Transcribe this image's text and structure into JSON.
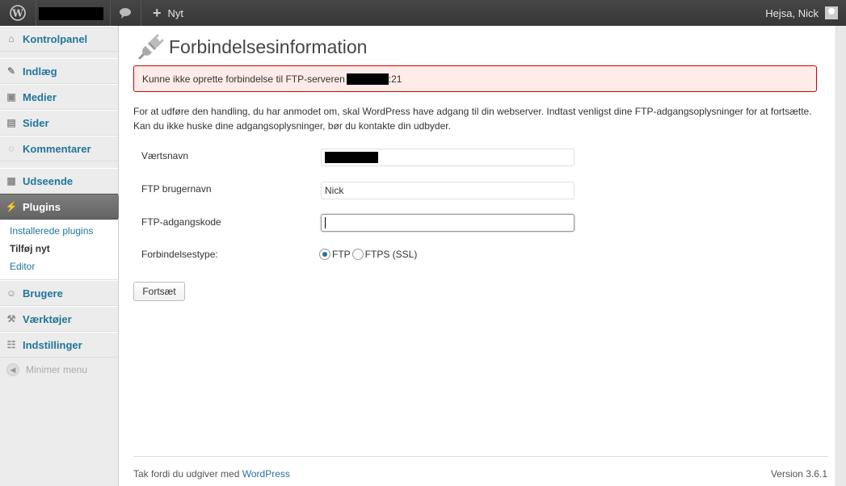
{
  "adminbar": {
    "new_label": "Nyt",
    "greeting": "Hejsa, Nick"
  },
  "menu": {
    "items": [
      {
        "label": "Kontrolpanel",
        "icon": "dashboard-icon"
      },
      {
        "label": "Indlæg",
        "icon": "pin-icon"
      },
      {
        "label": "Medier",
        "icon": "media-icon"
      },
      {
        "label": "Sider",
        "icon": "pages-icon"
      },
      {
        "label": "Kommentarer",
        "icon": "comments-icon"
      },
      {
        "label": "Udseende",
        "icon": "appearance-icon"
      },
      {
        "label": "Plugins",
        "icon": "plugins-icon"
      },
      {
        "label": "Brugere",
        "icon": "users-icon"
      },
      {
        "label": "Værktøjer",
        "icon": "tools-icon"
      },
      {
        "label": "Indstillinger",
        "icon": "settings-icon"
      }
    ],
    "submenu": [
      "Installerede plugins",
      "Tilføj nyt",
      "Editor"
    ],
    "collapse_label": "Minimer menu"
  },
  "page": {
    "title": "Forbindelsesinformation",
    "error_prefix": "Kunne ikke oprette forbindelse til FTP-serveren",
    "error_suffix": ":21",
    "intro": "For at udføre den handling, du har anmodet om, skal WordPress have adgang til din webserver. Indtast venligst dine FTP-adgangsoplysninger for at fortsætte. Kan du ikke huske dine adgangsoplysninger, bør du kontakte din udbyder."
  },
  "form": {
    "host_label": "Værtsnavn",
    "user_label": "FTP brugernavn",
    "user_value": "Nick",
    "password_label": "FTP-adgangskode",
    "conn_label": "Forbindelsestype:",
    "opt_ftp": "FTP",
    "opt_ftps": "FTPS (SSL)",
    "submit_label": "Fortsæt"
  },
  "footer": {
    "thanks": "Tak fordi du udgiver med",
    "link": "WordPress",
    "version": "Version 3.6.1"
  },
  "colors": {
    "link": "#21759b",
    "error_bg": "#ffebe8",
    "error_border": "#cc0000"
  }
}
